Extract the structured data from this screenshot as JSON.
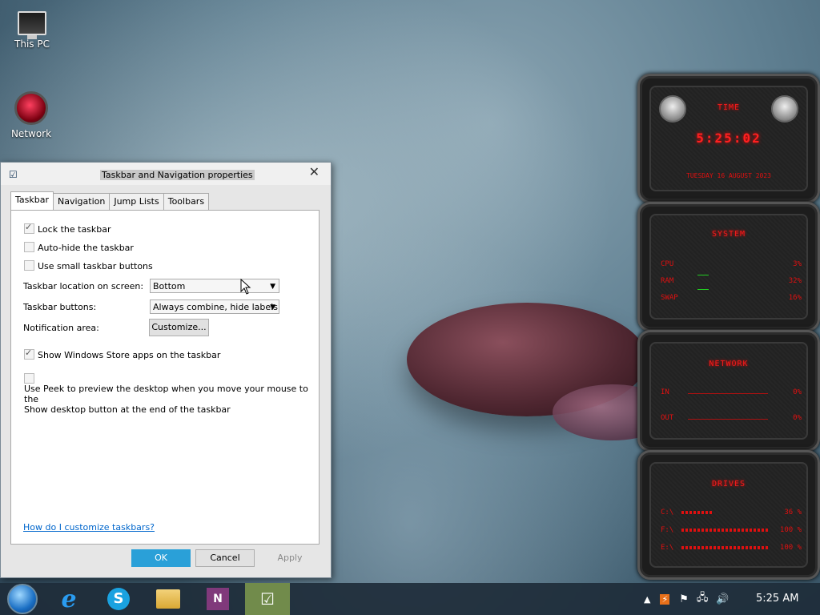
{
  "desktop": {
    "icons": [
      {
        "label": "This PC"
      },
      {
        "label": "Network"
      }
    ]
  },
  "dialog": {
    "title": "Taskbar and Navigation properties",
    "tabs": [
      {
        "label": "Taskbar"
      },
      {
        "label": "Navigation"
      },
      {
        "label": "Jump Lists"
      },
      {
        "label": "Toolbars"
      }
    ],
    "options": {
      "lock_taskbar": {
        "label": "Lock the taskbar",
        "checked": true
      },
      "auto_hide": {
        "label": "Auto-hide the taskbar",
        "checked": false
      },
      "small_buttons": {
        "label": "Use small taskbar buttons",
        "checked": false
      },
      "store_apps": {
        "label": "Show Windows Store apps on the taskbar",
        "checked": true
      },
      "peek": {
        "label": "Use Peek to preview the desktop when you move your mouse to the",
        "label2": "Show desktop button at the end of the taskbar",
        "checked": false
      }
    },
    "location": {
      "label": "Taskbar location on screen:",
      "value": "Bottom"
    },
    "buttons_setting": {
      "label": "Taskbar buttons:",
      "value": "Always combine, hide labels"
    },
    "notification": {
      "label": "Notification area:",
      "button": "Customize..."
    },
    "help_link": "How do I customize taskbars?",
    "ok": "OK",
    "cancel": "Cancel",
    "apply": "Apply"
  },
  "gadgets": {
    "time": {
      "title": "TIME",
      "clock": "5:25:02",
      "date": "TUESDAY 16 AUGUST 2023"
    },
    "system": {
      "title": "SYSTEM",
      "rows": [
        {
          "label": "CPU",
          "value": "3%"
        },
        {
          "label": "RAM",
          "value": "32%"
        },
        {
          "label": "SWAP",
          "value": "16%"
        }
      ]
    },
    "network": {
      "title": "NETWORK",
      "rows": [
        {
          "label": "IN",
          "value": "0%"
        },
        {
          "label": "OUT",
          "value": "0%"
        }
      ]
    },
    "drives": {
      "title": "DRIVES",
      "rows": [
        {
          "label": "C:\\",
          "value": "36 %",
          "fill": 0.36
        },
        {
          "label": "F:\\",
          "value": "100 %",
          "fill": 1.0
        },
        {
          "label": "E:\\",
          "value": "100 %",
          "fill": 1.0
        }
      ]
    }
  },
  "taskbar": {
    "clock": "5:25 AM",
    "apps": [
      "start-orb",
      "internet-explorer",
      "skype",
      "file-explorer",
      "onenote",
      "taskbar-properties"
    ]
  },
  "colors": {
    "accent": "#2aa0d8",
    "gadget_red": "#e01010",
    "taskbar": "#1e2d3a"
  }
}
